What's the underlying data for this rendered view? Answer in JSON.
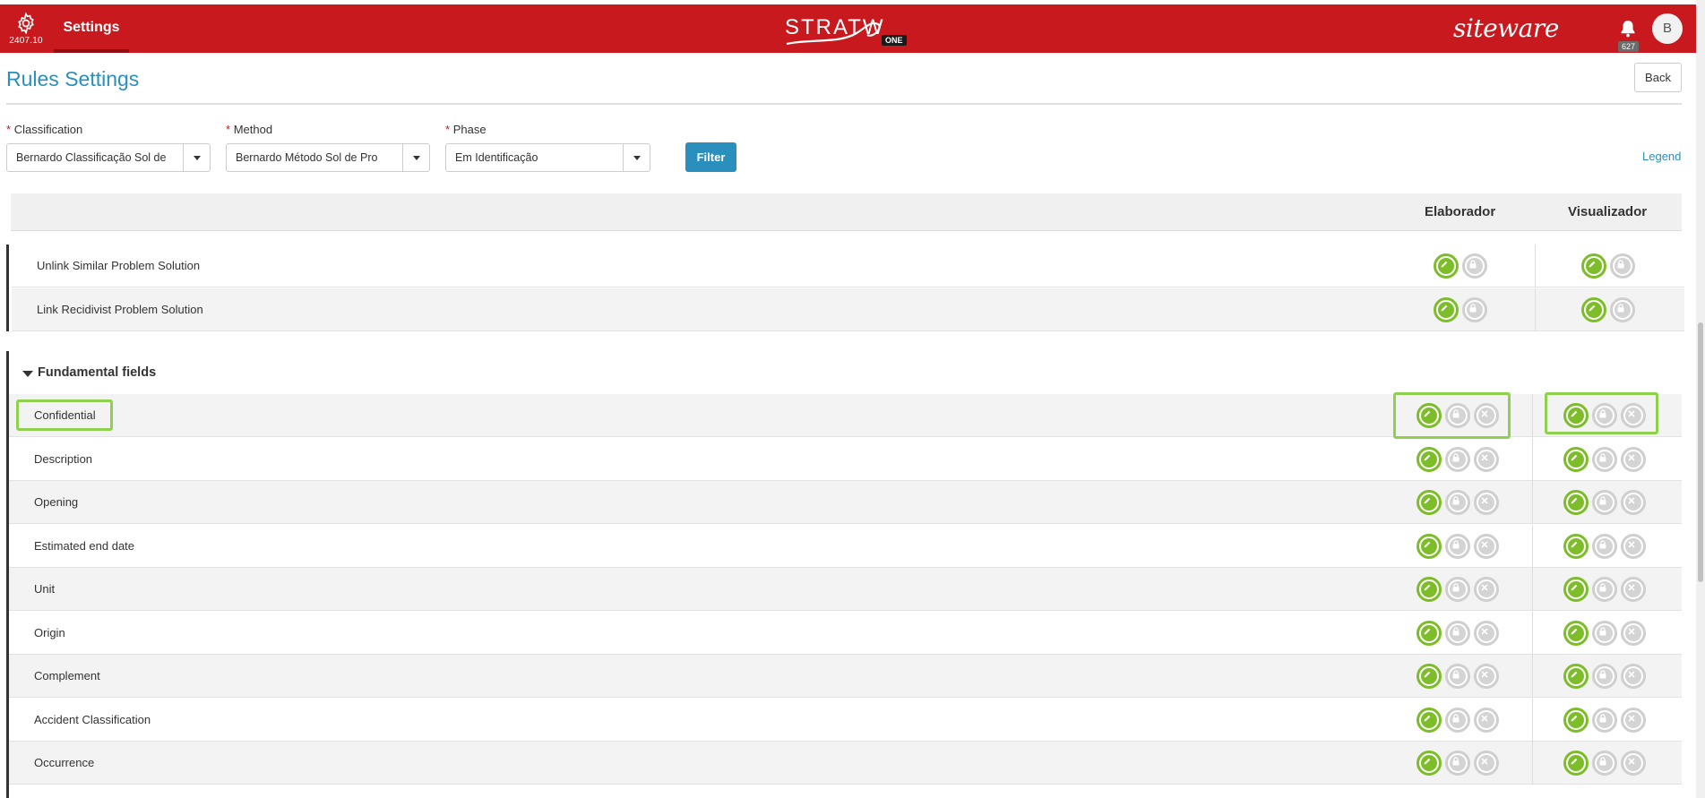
{
  "header": {
    "version": "2407.10",
    "settings_label": "Settings",
    "logo_text": "STRATW",
    "logo_badge": "ONE",
    "brand": "siteware",
    "notifications_count": "627",
    "avatar_initial": "B"
  },
  "page": {
    "title": "Rules Settings",
    "back_label": "Back"
  },
  "filters": {
    "classification": {
      "label": "Classification",
      "value": "Bernardo Classificação Sol de"
    },
    "method": {
      "label": "Method",
      "value": "Bernardo Método Sol de Pro"
    },
    "phase": {
      "label": "Phase",
      "value": "Em Identificação"
    },
    "filter_label": "Filter",
    "legend_label": "Legend",
    "required_mark": "*"
  },
  "table": {
    "columns": [
      "Elaborador",
      "Visualizador"
    ]
  },
  "top_rows": [
    {
      "label": "Unlink Similar Problem Solution"
    },
    {
      "label": "Link Recidivist Problem Solution"
    }
  ],
  "fundamental": {
    "title": "Fundamental fields",
    "rows": [
      {
        "label": "Confidential"
      },
      {
        "label": "Description"
      },
      {
        "label": "Opening"
      },
      {
        "label": "Estimated end date"
      },
      {
        "label": "Unit"
      },
      {
        "label": "Origin"
      },
      {
        "label": "Complement"
      },
      {
        "label": "Accident Classification"
      },
      {
        "label": "Occurrence"
      }
    ]
  },
  "colors": {
    "brand_red": "#c8191e",
    "accent_blue": "#2a8fbd",
    "allowed_green": "#7dbd2a",
    "disabled_gray": "#cfcfcf",
    "highlight_green": "#8fd14f"
  },
  "icons": {
    "edit": "pencil-icon",
    "lock": "lock-icon",
    "hidden": "x-icon",
    "settings": "gear-icon",
    "notifications": "bell-icon"
  }
}
